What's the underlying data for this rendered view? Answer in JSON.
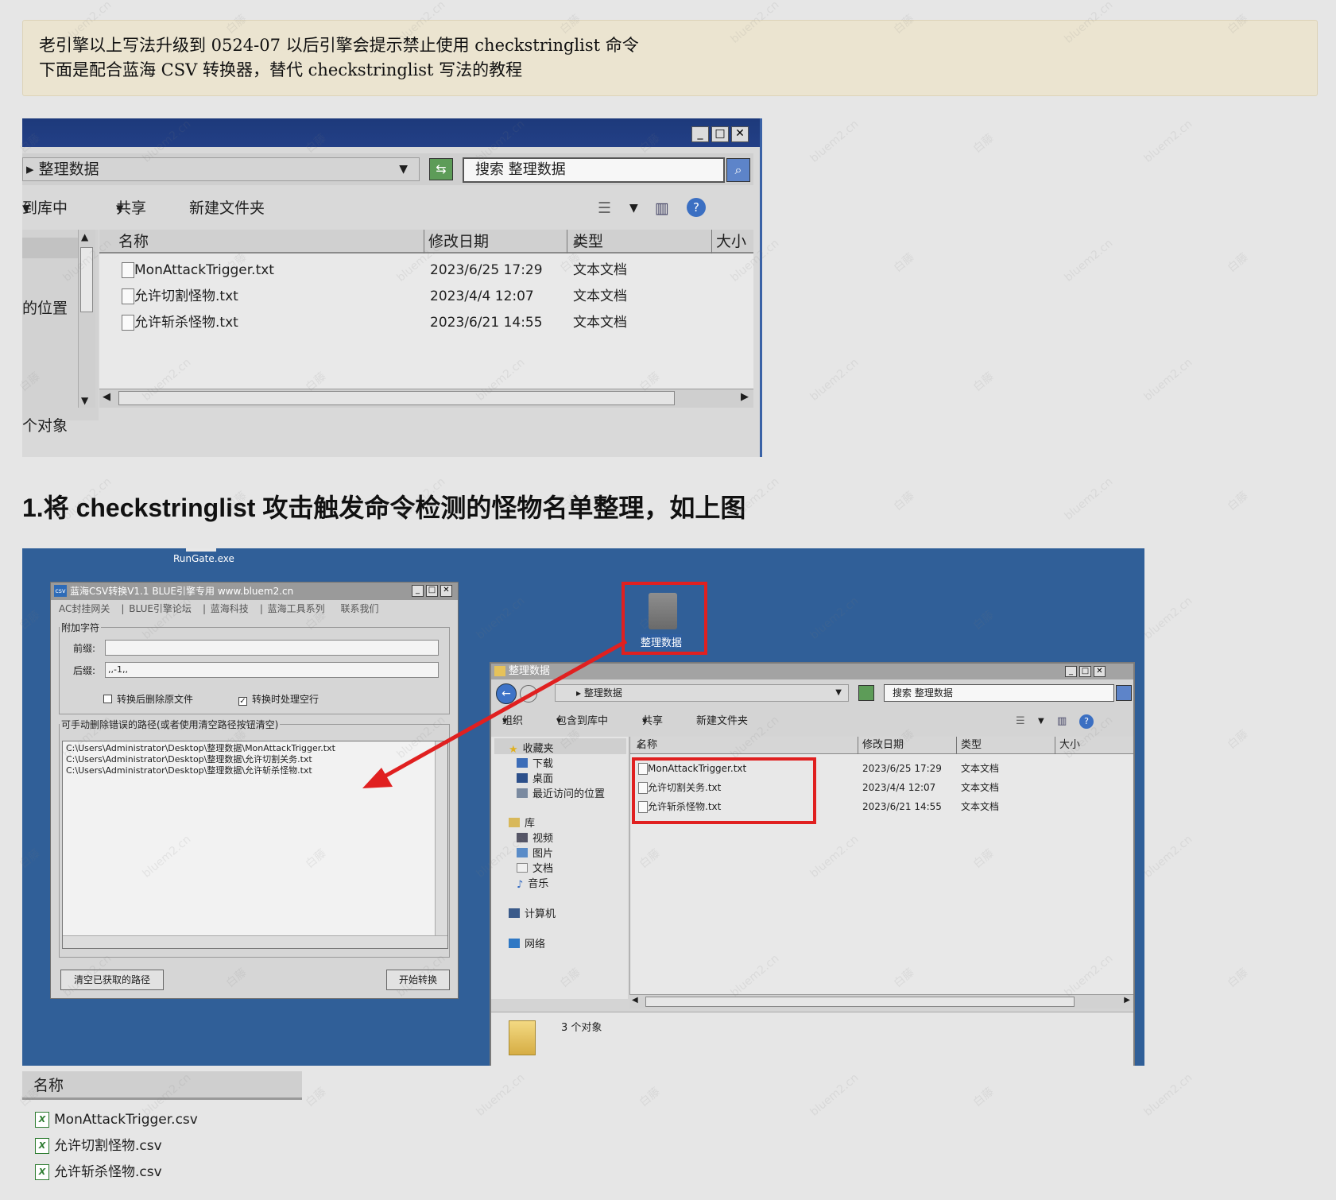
{
  "notice": {
    "line1": "老引擎以上写法升级到 0524-07 以后引擎会提示禁止使用 checkstringlist 命令",
    "line2": "下面是配合蓝海 CSV 转换器，替代 checkstringlist 写法的教程"
  },
  "explorer1": {
    "path": "整理数据",
    "search_placeholder": "搜索 整理数据",
    "toolbar": {
      "include": "到库中",
      "share": "共享",
      "new_folder": "新建文件夹"
    },
    "nav_item": "的位置",
    "columns": {
      "name": "名称",
      "date": "修改日期",
      "type": "类型",
      "size": "大小"
    },
    "files": [
      {
        "name": "MonAttackTrigger.txt",
        "date": "2023/6/25 17:29",
        "type": "文本文档"
      },
      {
        "name": "允许切割怪物.txt",
        "date": "2023/4/4 12:07",
        "type": "文本文档"
      },
      {
        "name": "允许斩杀怪物.txt",
        "date": "2023/6/21 14:55",
        "type": "文本文档"
      }
    ],
    "status": "个对象"
  },
  "heading": "1.将 checkstringlist 攻击触发命令检测的怪物名单整理，如上图",
  "desktop": {
    "rungate_label": "RunGate.exe",
    "folder_label": "整理数据",
    "csv_tool": {
      "logo": "csv",
      "title": "蓝海CSV转换V1.1  BLUE引擎专用 www.bluem2.cn",
      "menu": [
        "AC封挂网关",
        "BLUE引擎论坛",
        "蓝海科技",
        "蓝海工具系列",
        "联系我们"
      ],
      "group_label": "附加字符",
      "prefix_label": "前缀:",
      "prefix_value": "",
      "suffix_label": "后缀:",
      "suffix_value": ",,-1,,",
      "opt_delete": "转换后删除原文件",
      "opt_delete_checked": false,
      "opt_blank": "转换时处理空行",
      "opt_blank_checked": true,
      "paths_label": "可手动删除错误的路径(或者使用清空路径按钮清空)",
      "paths": [
        "C:\\Users\\Administrator\\Desktop\\整理数据\\MonAttackTrigger.txt",
        "C:\\Users\\Administrator\\Desktop\\整理数据\\允许切割关务.txt",
        "C:\\Users\\Administrator\\Desktop\\整理数据\\允许斩杀怪物.txt"
      ],
      "clear_button": "清空已获取的路径",
      "start_button": "开始转换"
    },
    "explorer2": {
      "title": "整理数据",
      "path": "整理数据",
      "search_placeholder": "搜索 整理数据",
      "toolbar": {
        "organize": "组织",
        "include": "包含到库中",
        "share": "共享",
        "new_folder": "新建文件夹"
      },
      "nav": {
        "favorites": "收藏夹",
        "downloads": "下载",
        "desktop": "桌面",
        "recent": "最近访问的位置",
        "libraries": "库",
        "videos": "视频",
        "pictures": "图片",
        "documents": "文档",
        "music": "音乐",
        "computer": "计算机",
        "network": "网络"
      },
      "columns": {
        "name": "名称",
        "date": "修改日期",
        "type": "类型",
        "size": "大小"
      },
      "files": [
        {
          "name": "MonAttackTrigger.txt",
          "date": "2023/6/25 17:29",
          "type": "文本文档"
        },
        {
          "name": "允许切割关务.txt",
          "date": "2023/4/4 12:07",
          "type": "文本文档"
        },
        {
          "name": "允许斩杀怪物.txt",
          "date": "2023/6/21 14:55",
          "type": "文本文档"
        }
      ],
      "status": "3 个对象"
    },
    "arrow_color": "#e02020"
  },
  "csv_files": {
    "header": "名称",
    "icon": "X",
    "files": [
      "MonAttackTrigger.csv",
      "允许切割怪物.csv",
      "允许斩杀怪物.csv"
    ]
  },
  "watermark": {
    "text1": "bluem2.cn",
    "text2": "白藤"
  }
}
